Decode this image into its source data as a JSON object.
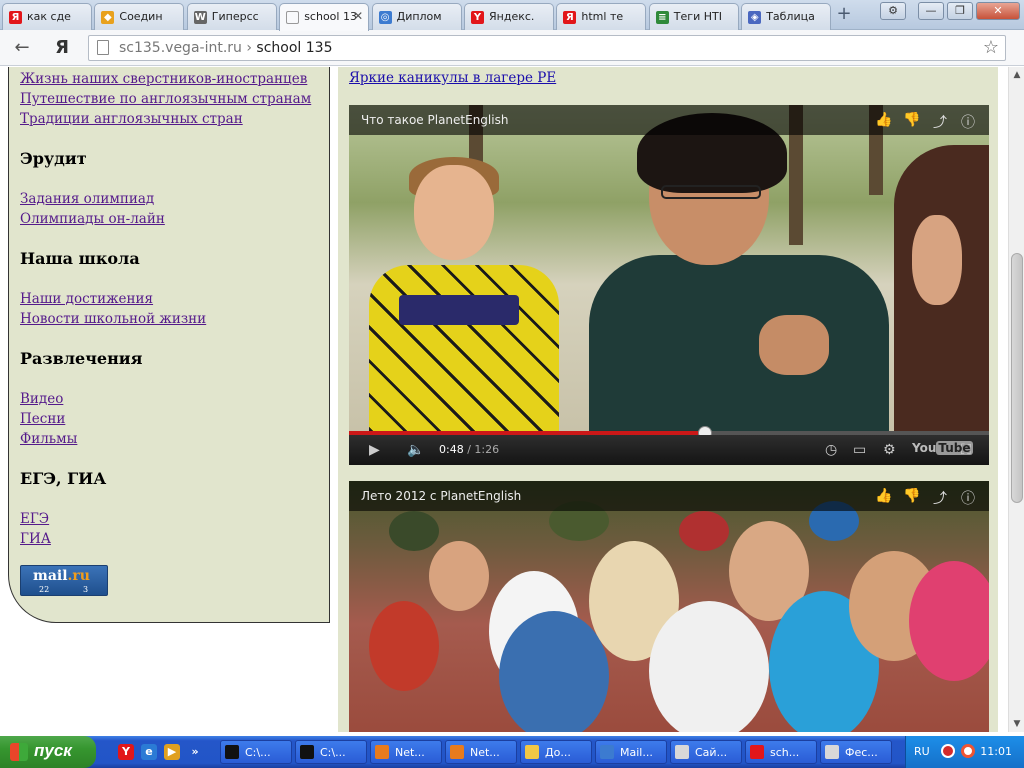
{
  "browser": {
    "tabs": [
      {
        "label": "как сде",
        "fav": "Я",
        "fav_color": "#e2161a"
      },
      {
        "label": "Соедин",
        "fav": "◆",
        "fav_color": "#e8a11d"
      },
      {
        "label": "Гиперсс",
        "fav": "W",
        "fav_color": "#666666"
      },
      {
        "label": "school 13",
        "fav": "",
        "fav_color": "#999999",
        "active": true
      },
      {
        "label": "Диплом",
        "fav": "◎",
        "fav_color": "#3c7bd0"
      },
      {
        "label": "Яндекс.",
        "fav": "Y",
        "fav_color": "#e2161a"
      },
      {
        "label": "html те",
        "fav": "Я",
        "fav_color": "#e2161a"
      },
      {
        "label": "Теги HTI",
        "fav": "≡",
        "fav_color": "#2f8a3a"
      },
      {
        "label": "Таблица",
        "fav": "◈",
        "fav_color": "#4a68c0"
      }
    ],
    "new_tab": "+",
    "window_buttons": {
      "settings": "⚙",
      "minimize": "—",
      "maximize": "❐",
      "close": "✕"
    },
    "back": "←",
    "yandex_button": "Я",
    "reload": "↻",
    "url_domain": "sc135.vega-int.ru",
    "url_sep": " › ",
    "url_path": "school 135",
    "bookmark": "☆"
  },
  "sidebar": {
    "top_links": [
      "Жизнь наших сверстников-иностранцев",
      "Путешествие по англоязычным странам",
      "Традиции англоязычных стран"
    ],
    "sections": [
      {
        "heading": "Эрудит",
        "links": [
          "Задания олимпиад",
          "Олимпиады он-лайн"
        ]
      },
      {
        "heading": "Наша школа",
        "links": [
          "Наши достижения",
          "Новости школьной жизни"
        ]
      },
      {
        "heading": "Развлечения",
        "links": [
          "Видео",
          "Песни",
          "Фильмы"
        ]
      },
      {
        "heading": "ЕГЭ, ГИА",
        "links": [
          "ЕГЭ",
          "ГИА"
        ]
      }
    ],
    "counter": {
      "logo_a": "mail",
      "logo_b": ".ru",
      "count_left": "22",
      "count_right": "3"
    }
  },
  "main": {
    "top_link": "Яркие каникулы в лагере PE",
    "video1": {
      "title": "Что такое PlanetEnglish",
      "time_current": "0:48",
      "time_sep": " / ",
      "time_total": "1:26",
      "progress": 0.557,
      "youtube_a": "You",
      "youtube_b": "Tube"
    },
    "video2": {
      "title": "Лето 2012  с PlanetEnglish"
    }
  },
  "icons": {
    "like": "👍",
    "dislike": "👎",
    "share": "⤴",
    "info": "ⓘ",
    "play": "▶",
    "volume": "🔈",
    "clock": "◷",
    "cc": "▭",
    "gear": "⚙",
    "fullscreen": "⛶"
  },
  "scroll": {
    "up": "▲",
    "down": "▼"
  },
  "taskbar": {
    "start_label": "пуск",
    "tasks": [
      {
        "label": "C:\\...",
        "color": "#111111"
      },
      {
        "label": "C:\\...",
        "color": "#111111"
      },
      {
        "label": "Net...",
        "color": "#e87b1d"
      },
      {
        "label": "Net...",
        "color": "#e87b1d"
      },
      {
        "label": "До...",
        "color": "#f2c744"
      },
      {
        "label": "Mail...",
        "color": "#3c7bd0"
      },
      {
        "label": "Сай...",
        "color": "#d8d8d8"
      },
      {
        "label": "sch...",
        "color": "#e2161a"
      },
      {
        "label": "Фес...",
        "color": "#d8d8d8"
      }
    ],
    "lang": "RU",
    "clock": "11:01"
  }
}
